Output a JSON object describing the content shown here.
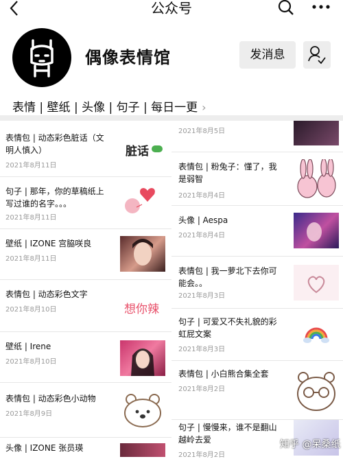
{
  "header": {
    "title": "公众号"
  },
  "profile": {
    "name": "偶像表情馆",
    "message_button": "发消息"
  },
  "menu": {
    "items": [
      "表情 | 壁纸 | 头像 | 句子 | 每日一更"
    ]
  },
  "left_articles": [
    {
      "title": "表情包 | 动态彩色脏话（文明人慎入）",
      "date": "2021年8月11日",
      "thumb_text": "脏话"
    },
    {
      "title": "句子 | 那年，你的草稿纸上写过谁的名字。。。",
      "date": "2021年8月11日"
    },
    {
      "title": "壁纸 | IZONE 宫脇咲良",
      "date": "2021年8月11日"
    },
    {
      "title": "表情包 | 动态彩色文字",
      "date": "2021年8月10日",
      "thumb_text": "想你辣"
    },
    {
      "title": "壁纸 | Irene",
      "date": "2021年8月10日"
    },
    {
      "title": "表情包 | 动态彩色小动物",
      "date": "2021年8月9日"
    },
    {
      "title": "头像 | IZONE 张员瑛",
      "date": ""
    }
  ],
  "right_articles": [
    {
      "title": "",
      "date": "2021年8月5日"
    },
    {
      "title": "表情包 | 粉兔子：懂了，我是弱智",
      "date": "2021年8月4日"
    },
    {
      "title": "头像 | Aespa",
      "date": "2021年8月4日"
    },
    {
      "title": "表情包 | 我一萝北下去你可能会。。",
      "date": "2021年8月3日"
    },
    {
      "title": "句子 | 可爱又不失礼貌的彩虹屁文案",
      "date": "2021年8月3日"
    },
    {
      "title": "表情包 | 小白熊合集全套",
      "date": "2021年8月2日"
    },
    {
      "title": "句子 | 慢慢来，谁不是翻山越岭去爱",
      "date": "2021年8月2日"
    }
  ],
  "watermark": "知乎 @呆桑纸",
  "colors": {
    "separator": "#ededed",
    "date_text": "#999999",
    "button_bg": "#ededed"
  }
}
